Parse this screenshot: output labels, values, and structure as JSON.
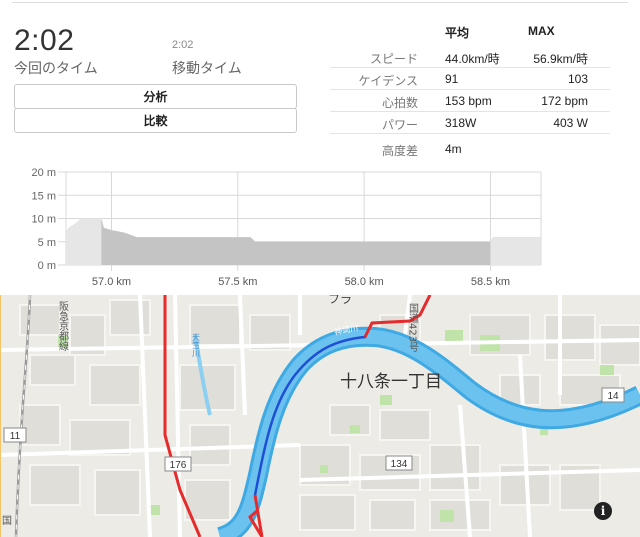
{
  "summary": {
    "elapsed_time": "2:02",
    "elapsed_label": "今回のタイム",
    "moving_time": "2:02",
    "moving_label": "移動タイム"
  },
  "buttons": {
    "analyze": "分析",
    "compare": "比較"
  },
  "stats": {
    "avg_header": "平均",
    "max_header": "MAX",
    "rows": [
      {
        "label": "スピード",
        "avg": "44.0km/時",
        "max": "56.9km/時"
      },
      {
        "label": "ケイデンス",
        "avg": "91",
        "max": "103"
      },
      {
        "label": "心拍数",
        "avg": "153 bpm",
        "max": "172 bpm"
      },
      {
        "label": "パワー",
        "avg": "318W",
        "max": "403 W"
      },
      {
        "label": "高度差",
        "avg": "4m",
        "max": ""
      }
    ]
  },
  "chart_data": {
    "type": "area",
    "xlabel": "",
    "ylabel": "",
    "xlim": [
      56.82,
      58.7
    ],
    "ylim": [
      0,
      20
    ],
    "y_ticks": [
      "20 m",
      "15 m",
      "10 m",
      "5 m",
      "0 m"
    ],
    "y_tick_values": [
      20,
      15,
      10,
      5,
      0
    ],
    "x_ticks": [
      "57.0 km",
      "57.5 km",
      "58.0 km",
      "58.5 km"
    ],
    "x_tick_values": [
      57.0,
      57.5,
      58.0,
      58.5
    ],
    "grid": true,
    "colors": {
      "fill": "#c4c4c4",
      "highlight": "#e6e6e6"
    },
    "series": [
      {
        "x": [
          56.82,
          56.83,
          56.86,
          56.88,
          56.96,
          56.97,
          57.0,
          57.05,
          57.1,
          57.5,
          57.55,
          57.56,
          57.57,
          57.6,
          57.8,
          58.0,
          58.2,
          58.4,
          58.5,
          58.51,
          58.7
        ],
        "y": [
          7,
          8,
          9,
          10,
          10,
          8,
          7.5,
          7,
          6,
          6,
          6,
          5.5,
          5,
          5,
          5,
          5,
          5,
          5,
          5,
          6,
          6
        ]
      }
    ],
    "highlight_ranges": [
      [
        56.82,
        56.96
      ],
      [
        58.5,
        58.7
      ]
    ]
  },
  "map": {
    "labels": {
      "district": "十八条一丁目",
      "route_176": "176",
      "route_134": "134",
      "route_11": "11",
      "route_14": "14",
      "rail_line": "阪急京都線",
      "road_423": "国道423号",
      "river_kanzaki": "神崎川",
      "river_small": "天竺川",
      "partial_fura": "フラ",
      "partial_road": "国"
    },
    "info_glyph": "i"
  }
}
